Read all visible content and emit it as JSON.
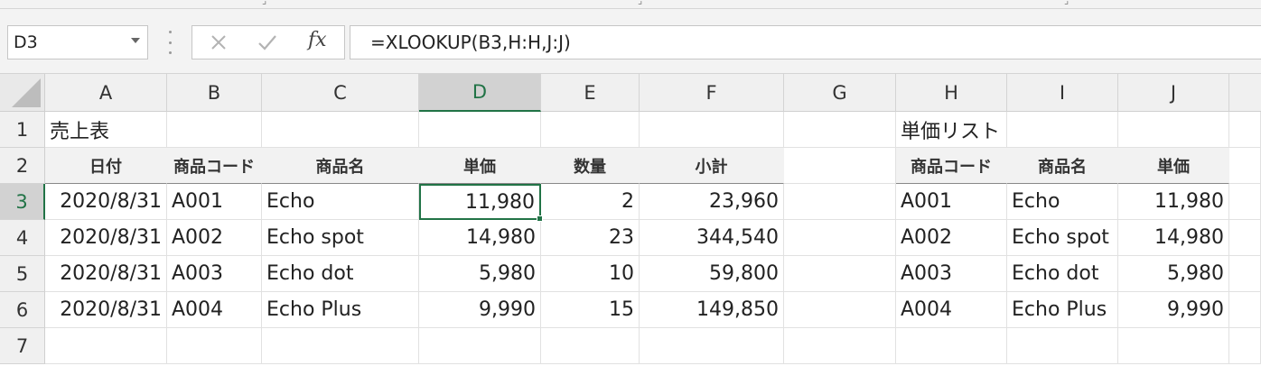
{
  "name_box": "D3",
  "formula": "=XLOOKUP(B3,H:H,J:J)",
  "columns": [
    "A",
    "B",
    "C",
    "D",
    "E",
    "F",
    "G",
    "H",
    "I",
    "J"
  ],
  "rows": [
    "1",
    "2",
    "3",
    "4",
    "5",
    "6",
    "7"
  ],
  "sales_title": "売上表",
  "price_title": "単価リスト",
  "sales_headers": [
    "日付",
    "商品コード",
    "商品名",
    "単価",
    "数量",
    "小計"
  ],
  "price_headers": [
    "商品コード",
    "商品名",
    "単価"
  ],
  "sales_rows": [
    [
      "2020/8/31",
      "A001",
      "Echo",
      "11,980",
      "2",
      "23,960"
    ],
    [
      "2020/8/31",
      "A002",
      "Echo spot",
      "14,980",
      "23",
      "344,540"
    ],
    [
      "2020/8/31",
      "A003",
      "Echo dot",
      "5,980",
      "10",
      "59,800"
    ],
    [
      "2020/8/31",
      "A004",
      "Echo Plus",
      "9,990",
      "15",
      "149,850"
    ]
  ],
  "price_rows": [
    [
      "A001",
      "Echo",
      "11,980"
    ],
    [
      "A002",
      "Echo spot",
      "14,980"
    ],
    [
      "A003",
      "Echo dot",
      "5,980"
    ],
    [
      "A004",
      "Echo Plus",
      "9,990"
    ]
  ],
  "colors": {
    "accent": "#217346",
    "header_bg": "#f2f2f2"
  }
}
